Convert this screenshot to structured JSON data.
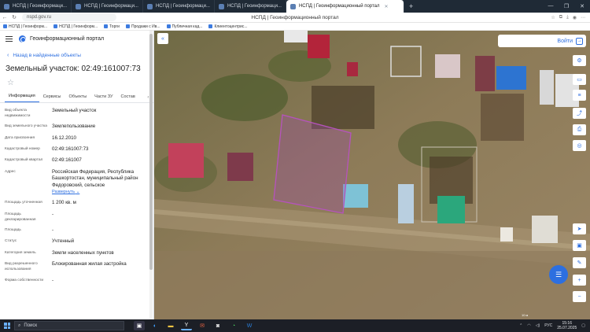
{
  "browser": {
    "tabs": [
      {
        "label": "НСПД | Геоинформаци..."
      },
      {
        "label": "НСПД | Геоинформаци..."
      },
      {
        "label": "НСПД | Геоинформаци..."
      },
      {
        "label": "НСПД | Геоинформаци..."
      },
      {
        "label": "НСПД | Геоинформационный портал",
        "active": true
      }
    ],
    "new_tab": "+",
    "url": "nspd.gov.ru",
    "page_title": "НСПД | Геоинформационный портал",
    "bookmarks": [
      "НСПД | Геоинформ...",
      "НСПД | Геоинформ...",
      "Торги",
      "Продажи с Ив...",
      "Публичная кад...",
      "Клиентоцентрис..."
    ]
  },
  "panel": {
    "app_name": "Геоинформационный портал",
    "back_link": "Назад в найденные объекты",
    "title": "Земельный участок: 02:49:161007:73",
    "tabs": [
      "Информация",
      "Сервисы",
      "Объекты",
      "Части ЗУ",
      "Состав"
    ],
    "properties": [
      {
        "key": "Вид объекта недвижимости",
        "value": "Земельный участок"
      },
      {
        "key": "Вид земельного участка",
        "value": "Землепользование"
      },
      {
        "key": "Дата присвоения",
        "value": "16.12.2010"
      },
      {
        "key": "Кадастровый номер",
        "value": "02:49:161007:73"
      },
      {
        "key": "Кадастровый квартал",
        "value": "02:49:161007"
      },
      {
        "key": "Адрес",
        "value": "Российская Федерация, Республика Башкортостан, муниципальный район Федоровский, сельское",
        "link": "Развернуть"
      },
      {
        "key": "Площадь уточненная",
        "value": "1 200 кв. м"
      },
      {
        "key": "Площадь декларированная",
        "value": "-"
      },
      {
        "key": "Площадь",
        "value": "-"
      },
      {
        "key": "Статус",
        "value": "Учтенный"
      },
      {
        "key": "Категория земель",
        "value": "Земли населенных пунктов"
      },
      {
        "key": "Вид разрешенного использования",
        "value": "Блокированная жилая застройка"
      },
      {
        "key": "Форма собственности",
        "value": "-"
      }
    ]
  },
  "map": {
    "login_label": "Войти",
    "scale_label": "10 м"
  },
  "taskbar": {
    "search_placeholder": "Поиск",
    "lang": "РУС",
    "time": "15:16",
    "date": "25.07.2025"
  },
  "colors": {
    "accent": "#2d6fe0",
    "parcel": "#a04aa8"
  }
}
